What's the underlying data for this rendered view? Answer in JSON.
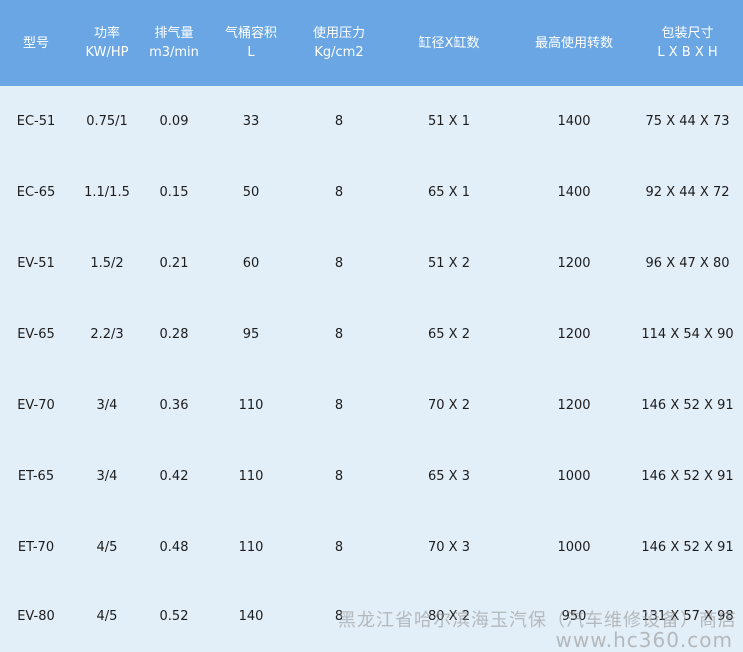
{
  "headers": [
    {
      "line1": "型号",
      "line2": ""
    },
    {
      "line1": "功率",
      "line2": "KW/HP"
    },
    {
      "line1": "排气量",
      "line2": "m3/min"
    },
    {
      "line1": "气桶容积",
      "line2": "L"
    },
    {
      "line1": "使用压力",
      "line2": "Kg/cm2"
    },
    {
      "line1": "缸径X缸数",
      "line2": ""
    },
    {
      "line1": "最高使用转数",
      "line2": ""
    },
    {
      "line1": "包装尺寸",
      "line2": "L X B X H"
    }
  ],
  "rows": [
    [
      "EC-51",
      "0.75/1",
      "0.09",
      "33",
      "8",
      "51 X 1",
      "1400",
      "75 X 44 X 73"
    ],
    [
      "EC-65",
      "1.1/1.5",
      "0.15",
      "50",
      "8",
      "65 X 1",
      "1400",
      "92 X 44 X 72"
    ],
    [
      "EV-51",
      "1.5/2",
      "0.21",
      "60",
      "8",
      "51 X 2",
      "1200",
      "96 X 47 X 80"
    ],
    [
      "EV-65",
      "2.2/3",
      "0.28",
      "95",
      "8",
      "65 X 2",
      "1200",
      "114 X 54 X 90"
    ],
    [
      "EV-70",
      "3/4",
      "0.36",
      "110",
      "8",
      "70 X 2",
      "1200",
      "146 X 52 X 91"
    ],
    [
      "ET-65",
      "3/4",
      "0.42",
      "110",
      "8",
      "65 X 3",
      "1000",
      "146 X 52 X 91"
    ],
    [
      "ET-70",
      "4/5",
      "0.48",
      "110",
      "8",
      "70 X 3",
      "1000",
      "146 X 52 X 91"
    ],
    [
      "EV-80",
      "4/5",
      "0.52",
      "140",
      "8",
      "80 X 2",
      "950",
      "131 X 57 X 98"
    ]
  ],
  "watermark": {
    "line1": "黑龙江省哈尔滨海玉汽保（汽车维修设备）商店",
    "line2": "www.hc360.com"
  },
  "colors": {
    "header_bg": "#6aa6e4",
    "body_bg": "#e2eef8",
    "header_text": "#ffffff",
    "body_text": "#1d1d1d"
  }
}
